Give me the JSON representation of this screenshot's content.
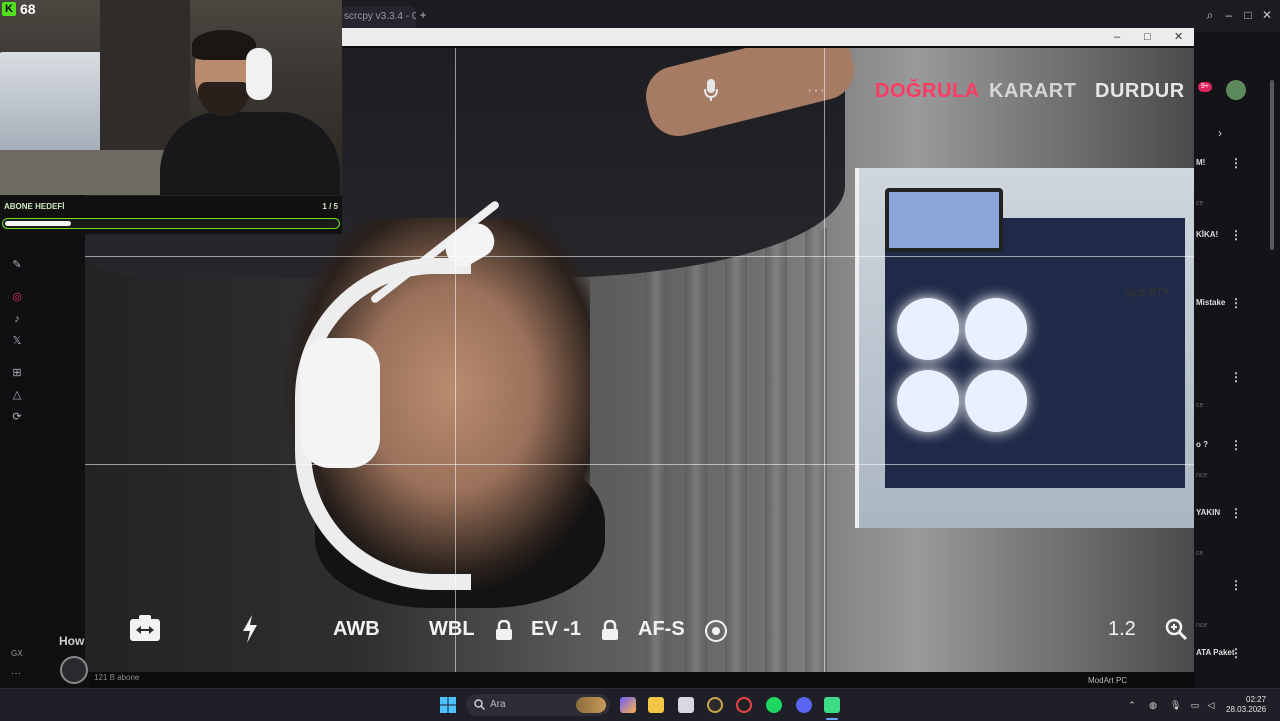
{
  "stream_overlay": {
    "viewer_count": "68",
    "logo_letter": "K",
    "goal_label": "ABONE HEDEFİ",
    "goal_count": "1 / 5",
    "goal_progress_fraction": 0.2,
    "accent_color": "#6fdc2b"
  },
  "browser": {
    "tab_title": "scrcpy v3.3.4 - Ge",
    "new_tab_label": "+",
    "window_controls": [
      "search-icon",
      "minimize-icon",
      "maximize-icon",
      "close-icon"
    ]
  },
  "scrcpy_window": {
    "controls": {
      "minimize": "–",
      "maximize": "□",
      "close": "✕"
    }
  },
  "camera_app": {
    "top": {
      "verify_label": "DOĞRULA",
      "snapshot_label": "KARART",
      "stop_label": "DURDUR",
      "more_label": "···"
    },
    "bottom": {
      "awb_label": "AWB",
      "wbl_label": "WBL",
      "ev_label": "EV -1",
      "af_label": "AF-S",
      "zoom_value": "1.2"
    },
    "scene_label": "RCE RTX",
    "verify_color": "#ff3b63"
  },
  "right_page": {
    "rows": [
      {
        "text": "M!",
        "sub": ""
      },
      {
        "text": "KİKA!",
        "sub": "ce"
      },
      {
        "text": "Mistake",
        "sub": ""
      },
      {
        "text": "",
        "sub": "ce"
      },
      {
        "text": "o ?",
        "sub": "nce"
      },
      {
        "text": "YAKIN",
        "sub": "ce"
      },
      {
        "text": "",
        "sub": "nce"
      },
      {
        "text": "ATA Paket",
        "sub": ""
      }
    ],
    "badge": "9+"
  },
  "left_page": {
    "how_text": "How",
    "subs_text": "121 B abone",
    "gx_text": "GX",
    "more_text": "···",
    "footer_channel": "ModArt PC"
  },
  "taskbar": {
    "search_placeholder": "Ara",
    "clock_time": "02:27",
    "clock_date": "28.03.2026"
  }
}
